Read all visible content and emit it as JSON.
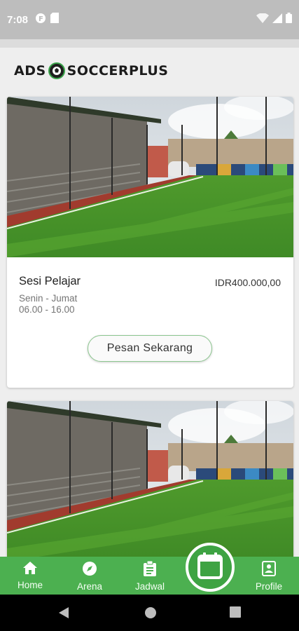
{
  "status_bar": {
    "time": "7:08"
  },
  "header": {
    "logo_left": "ADS",
    "logo_right": "SOCCERPLUS"
  },
  "cards": [
    {
      "title": "Sesi Pelajar",
      "price": "IDR400.000,00",
      "days": "Senin - Jumat",
      "hours": "06.00 - 16.00",
      "button_label": "Pesan Sekarang"
    }
  ],
  "nav": {
    "home": "Home",
    "arena": "Arena",
    "jadwal": "Jadwal",
    "profile": "Profile"
  },
  "colors": {
    "primary_green": "#4cb050",
    "fab_green": "#3ea343",
    "status_bar": "#bdbdbd"
  },
  "icons": [
    "home-icon",
    "compass-icon",
    "clipboard-icon",
    "calendar-icon",
    "profile-icon"
  ]
}
